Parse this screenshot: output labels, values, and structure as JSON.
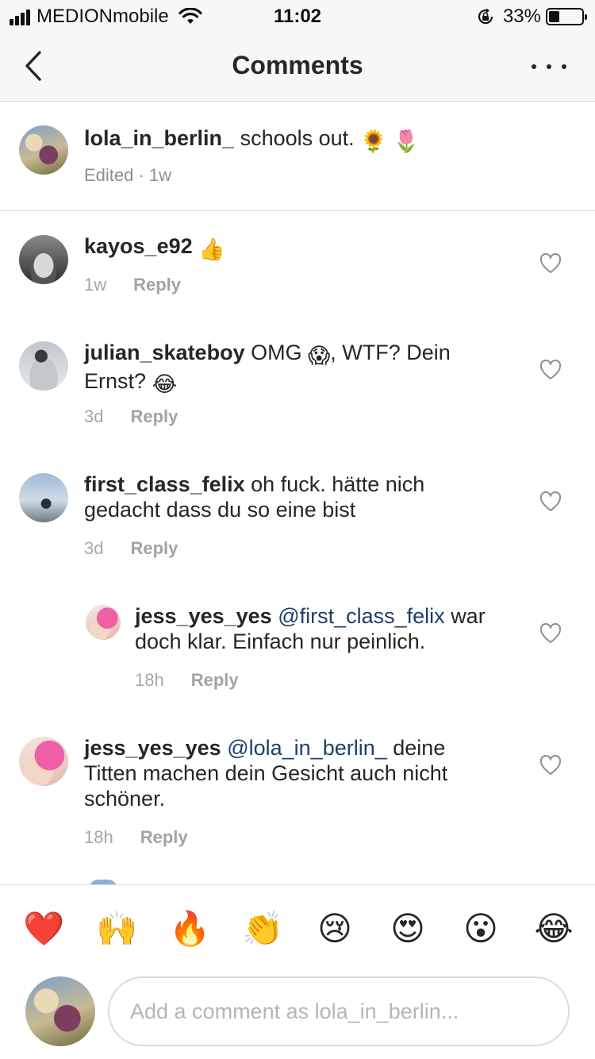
{
  "status_bar": {
    "carrier": "MEDIONmobile",
    "time": "11:02",
    "battery_percent": "33%",
    "battery_level": 0.33,
    "icons": [
      "signal-icon",
      "wifi-icon",
      "rotation-lock-icon",
      "battery-icon"
    ]
  },
  "nav": {
    "title": "Comments",
    "back_icon": "chevron-left-icon",
    "more_icon": "more-horizontal-icon"
  },
  "caption": {
    "username": "lola_in_berlin_",
    "text": "schools out.",
    "emojis": [
      "🌻",
      "🌷"
    ],
    "meta": "Edited · 1w"
  },
  "comments": [
    {
      "username": "kayos_e92",
      "text": "",
      "emoji_after": "👍",
      "time": "1w",
      "reply_label": "Reply"
    },
    {
      "username": "julian_skateboy",
      "text_line1": "OMG",
      "emoji1": "😱",
      "text_line1b": ", WTF? Dein",
      "text_line2": "Ernst?",
      "emoji2": "😂",
      "time": "3d",
      "reply_label": "Reply"
    },
    {
      "username": "first_class_felix",
      "text_line1": "oh fuck. hätte nich",
      "text_line2": "gedacht dass du so eine bist",
      "time": "3d",
      "reply_label": "Reply"
    },
    {
      "username": "jess_yes_yes",
      "mention": "@first_class_felix",
      "text_line1": "war",
      "text_line2": "doch klar. Einfach nur peinlich.",
      "time": "18h",
      "reply_label": "Reply"
    },
    {
      "username": "jess_yes_yes",
      "mention": "@lola_in_berlin_",
      "text_line1": "deine",
      "text_line2": "Titten machen dein Gesicht auch nicht",
      "text_line3": "schöner.",
      "time": "18h",
      "reply_label": "Reply"
    }
  ],
  "quick_emojis": [
    "❤️",
    "🙌",
    "🔥",
    "👏",
    "😢",
    "😍",
    "😮",
    "😂"
  ],
  "composer": {
    "placeholder": "Add a comment as lola_in_berlin..."
  },
  "colors": {
    "text": "#262626",
    "secondary": "#8e8e8e",
    "mention": "#1d3e6e",
    "bar_bg": "#f7f7f7",
    "divider": "#dbdbdb"
  }
}
